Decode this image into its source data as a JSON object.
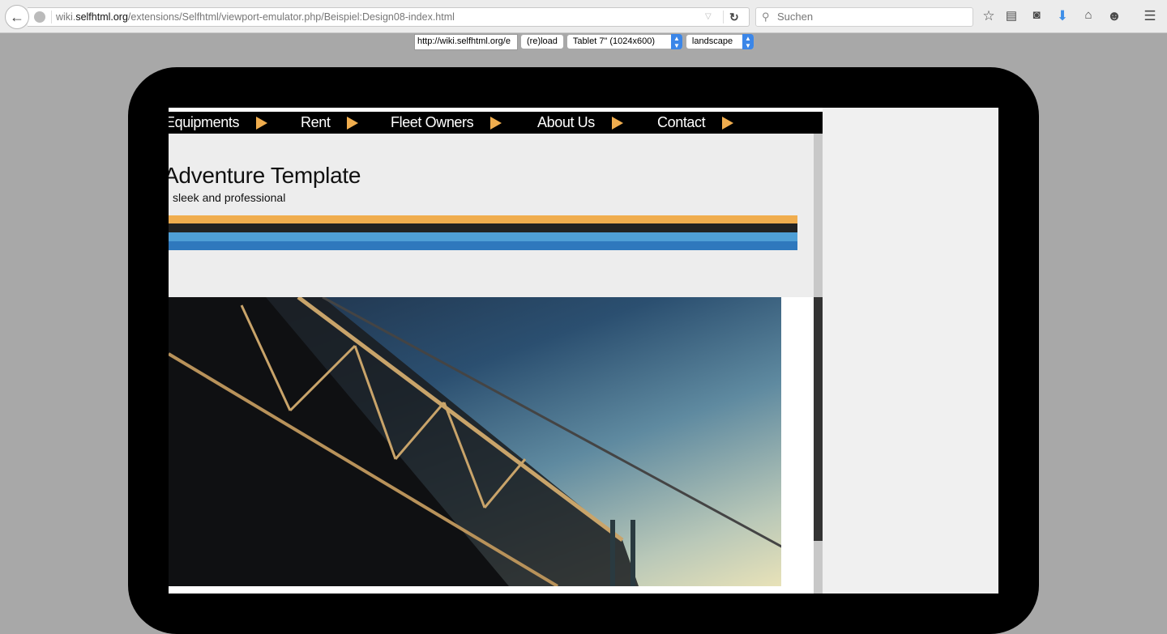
{
  "browser": {
    "url_prefix": "wiki.",
    "url_domain": "selfhtml.org",
    "url_path": "/extensions/Selfhtml/viewport-emulator.php/Beispiel:Design08-index.html",
    "search_placeholder": "Suchen",
    "icons": [
      "back-icon",
      "globe-icon",
      "dropdown-icon",
      "reload-icon",
      "search-icon",
      "bookmark-star-icon",
      "reading-list-icon",
      "pocket-icon",
      "download-icon",
      "home-icon",
      "chat-icon",
      "menu-icon"
    ],
    "download_color": "#3d8ee8"
  },
  "emulator": {
    "url_value": "http://wiki.selfhtml.org/e",
    "reload_label": "(re)load",
    "device_selected": "Tablet 7\" (1024x600)",
    "orientation_selected": "landscape"
  },
  "site": {
    "nav": [
      "Equipments",
      "Rent",
      "Fleet Owners",
      "About Us",
      "Contact"
    ],
    "title": "Adventure Template",
    "tagline": "sleek and professional",
    "colors": {
      "orange": "#f0ad4e",
      "dark": "#222222",
      "light_blue": "#4f9fd6",
      "blue": "#2f78bd"
    }
  }
}
